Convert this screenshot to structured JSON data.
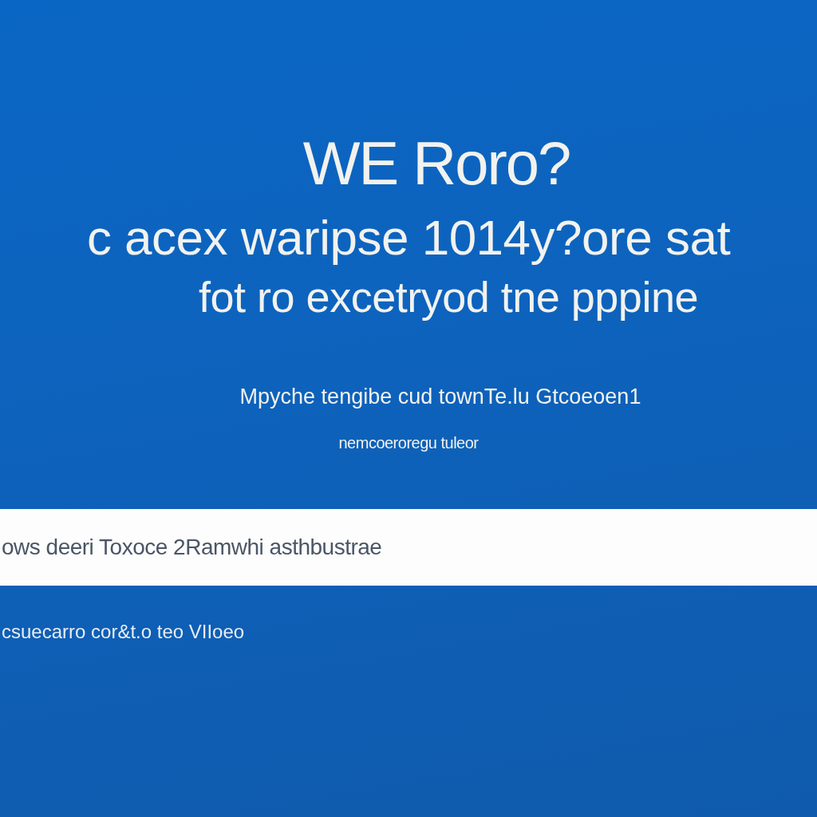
{
  "heading": "WE Roro?",
  "lines": [
    "c acex waripse 1014y?ore sat",
    "fot ro excetryod tne pppine"
  ],
  "details": [
    "Mpyche tengibe cud townTe.lu Gtcoeoen1",
    "nemcoeroregu tuleor"
  ],
  "bar": {
    "text": "ows deeri Toxoce 2Ramwhi asthbustrae"
  },
  "footer": "csuecarro cor&t.o teo VIIoeo"
}
